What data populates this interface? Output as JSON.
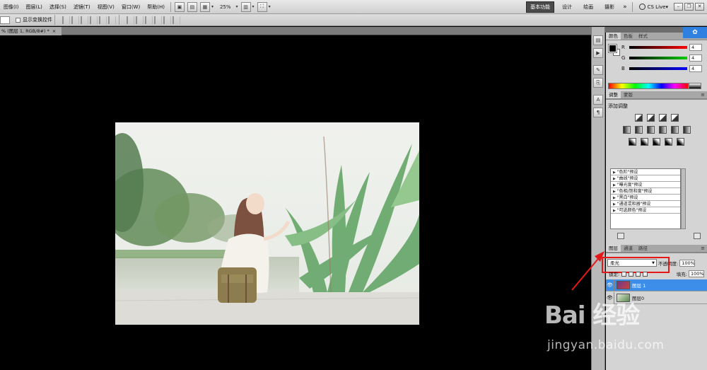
{
  "menubar": {
    "items": [
      "图像(I)",
      "图层(L)",
      "选择(S)",
      "滤镜(T)",
      "视图(V)",
      "窗口(W)",
      "帮助(H)"
    ],
    "zoom": "25%",
    "workspaces": [
      "基本功能",
      "设计",
      "绘画",
      "摄影"
    ],
    "active_workspace": "基本功能",
    "more": "»",
    "cslive": "CS Live"
  },
  "options": {
    "show_transform": "显示变换控件"
  },
  "document": {
    "tab_title": "% (图层 1, RGB/8#) *"
  },
  "color_panel": {
    "tabs": [
      "颜色",
      "色板",
      "样式"
    ],
    "channels": [
      {
        "label": "R",
        "value": "4",
        "color": "#d01010"
      },
      {
        "label": "G",
        "value": "4",
        "color": "#10a010"
      },
      {
        "label": "B",
        "value": "4",
        "color": "#1030d0"
      }
    ]
  },
  "adjust_panel": {
    "tabs": [
      "调整",
      "蒙版"
    ],
    "title": "添加调整",
    "presets": [
      "\"色阶\"预设",
      "\"曲线\"预设",
      "\"曝光度\"预设",
      "\"色相/饱和度\"预设",
      "\"黑白\"预设",
      "\"通道混和器\"预设",
      "\"可选颜色\"预设"
    ]
  },
  "layers_panel": {
    "tabs": [
      "图层",
      "通道",
      "路径"
    ],
    "blend_mode": "柔光",
    "opacity_label": "不透明度:",
    "opacity": "100%",
    "lock_label": "锁定:",
    "fill_label": "填充:",
    "fill": "100%",
    "layers": [
      {
        "name": "图层 1",
        "selected": true
      },
      {
        "name": "图层0",
        "selected": false
      }
    ]
  },
  "watermark": {
    "brand": "Bai 经验",
    "site": "jingyan.baidu.com"
  }
}
